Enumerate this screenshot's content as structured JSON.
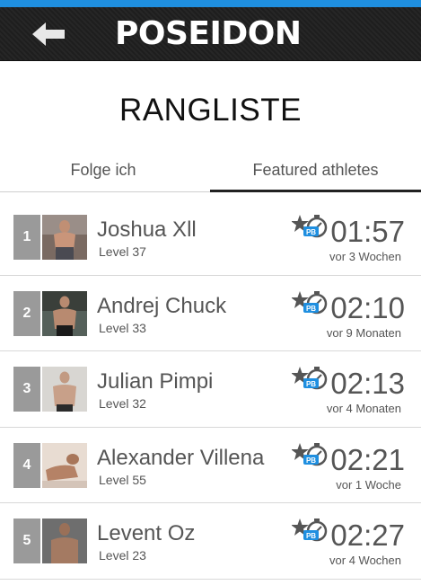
{
  "app": {
    "brand": "POSEIDON",
    "back_icon": "back-arrow-icon"
  },
  "page": {
    "title": "RANGLISTE"
  },
  "tabs": [
    {
      "label": "Folge ich",
      "active": false
    },
    {
      "label": "Featured athletes",
      "active": true
    }
  ],
  "badge": {
    "text": "PB",
    "icon": "star-stopwatch-pb-icon"
  },
  "athletes": [
    {
      "rank": "1",
      "name": "Joshua Xll",
      "level": "Level 37",
      "time": "01:57",
      "ago": "vor 3 Wochen"
    },
    {
      "rank": "2",
      "name": "Andrej Chuck",
      "level": "Level 33",
      "time": "02:10",
      "ago": "vor 9 Monaten"
    },
    {
      "rank": "3",
      "name": "Julian Pimpi",
      "level": "Level 32",
      "time": "02:13",
      "ago": "vor 4 Monaten"
    },
    {
      "rank": "4",
      "name": "Alexander Villena",
      "level": "Level 55",
      "time": "02:21",
      "ago": "vor 1 Woche"
    },
    {
      "rank": "5",
      "name": "Levent Oz",
      "level": "Level 23",
      "time": "02:27",
      "ago": "vor 4 Wochen"
    }
  ],
  "colors": {
    "accent": "#1f8fe0",
    "header": "#222222",
    "rank_box": "#9a9a9a"
  }
}
